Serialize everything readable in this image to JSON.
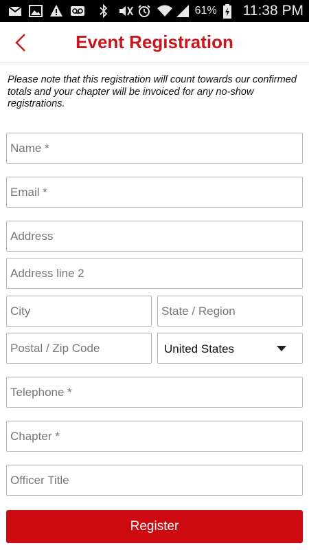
{
  "status_bar": {
    "battery_percent": "61%",
    "time": "11:38 PM",
    "left_icons": [
      "mail-icon",
      "gallery-icon",
      "warning-icon",
      "voicemail-icon"
    ],
    "right_icons": [
      "bluetooth-icon",
      "mute-icon",
      "alarm-icon",
      "wifi-icon",
      "signal-icon",
      "battery-charging-icon"
    ]
  },
  "header": {
    "title": "Event Registration",
    "back_icon": "chevron-left-icon"
  },
  "notice": "Please note that this registration will count towards our confirmed totals and your chapter will be invoiced for any no-show registrations.",
  "form": {
    "name": {
      "placeholder": "Name *",
      "value": ""
    },
    "email": {
      "placeholder": "Email *",
      "value": ""
    },
    "address": {
      "placeholder": "Address",
      "value": ""
    },
    "address2": {
      "placeholder": "Address line 2",
      "value": ""
    },
    "city": {
      "placeholder": "City",
      "value": ""
    },
    "state": {
      "placeholder": "State / Region",
      "value": ""
    },
    "postal": {
      "placeholder": "Postal / Zip Code",
      "value": ""
    },
    "country": {
      "selected": "United States"
    },
    "telephone": {
      "placeholder": "Telephone *",
      "value": ""
    },
    "chapter": {
      "placeholder": "Chapter *",
      "value": ""
    },
    "officer_title": {
      "placeholder": "Officer Title",
      "value": ""
    }
  },
  "register_label": "Register",
  "colors": {
    "brand_red": "#c8161d",
    "button_red": "#cc0a10",
    "field_border": "#b4b4b4",
    "placeholder": "#777777"
  }
}
